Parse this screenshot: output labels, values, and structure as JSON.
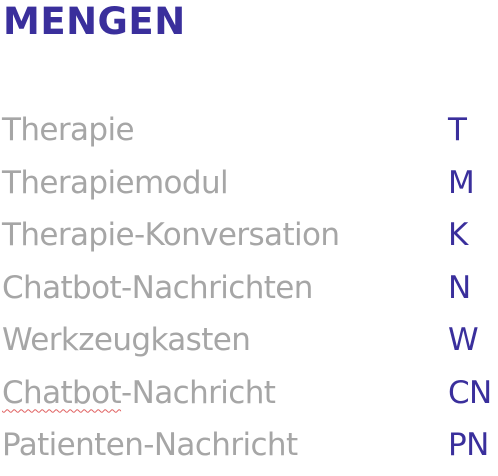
{
  "title": "MENGEN",
  "colors": {
    "title": "#3a2f9c",
    "term": "#a6a6a6",
    "symbol": "#3a2f9c"
  },
  "sets": [
    {
      "term": "Therapie",
      "symbol": "T"
    },
    {
      "term": "Therapiemodul",
      "symbol": "M"
    },
    {
      "term": "Therapie-Konversation",
      "symbol": "K"
    },
    {
      "term": "Chatbot-Nachrichten",
      "symbol": "N"
    },
    {
      "term": "Werkzeugkasten",
      "symbol": "W"
    },
    {
      "term_underlined": "Chatbot",
      "term_rest": "-Nachricht",
      "symbol": "CN"
    },
    {
      "term": "Patienten-Nachricht",
      "symbol": "PN"
    }
  ]
}
